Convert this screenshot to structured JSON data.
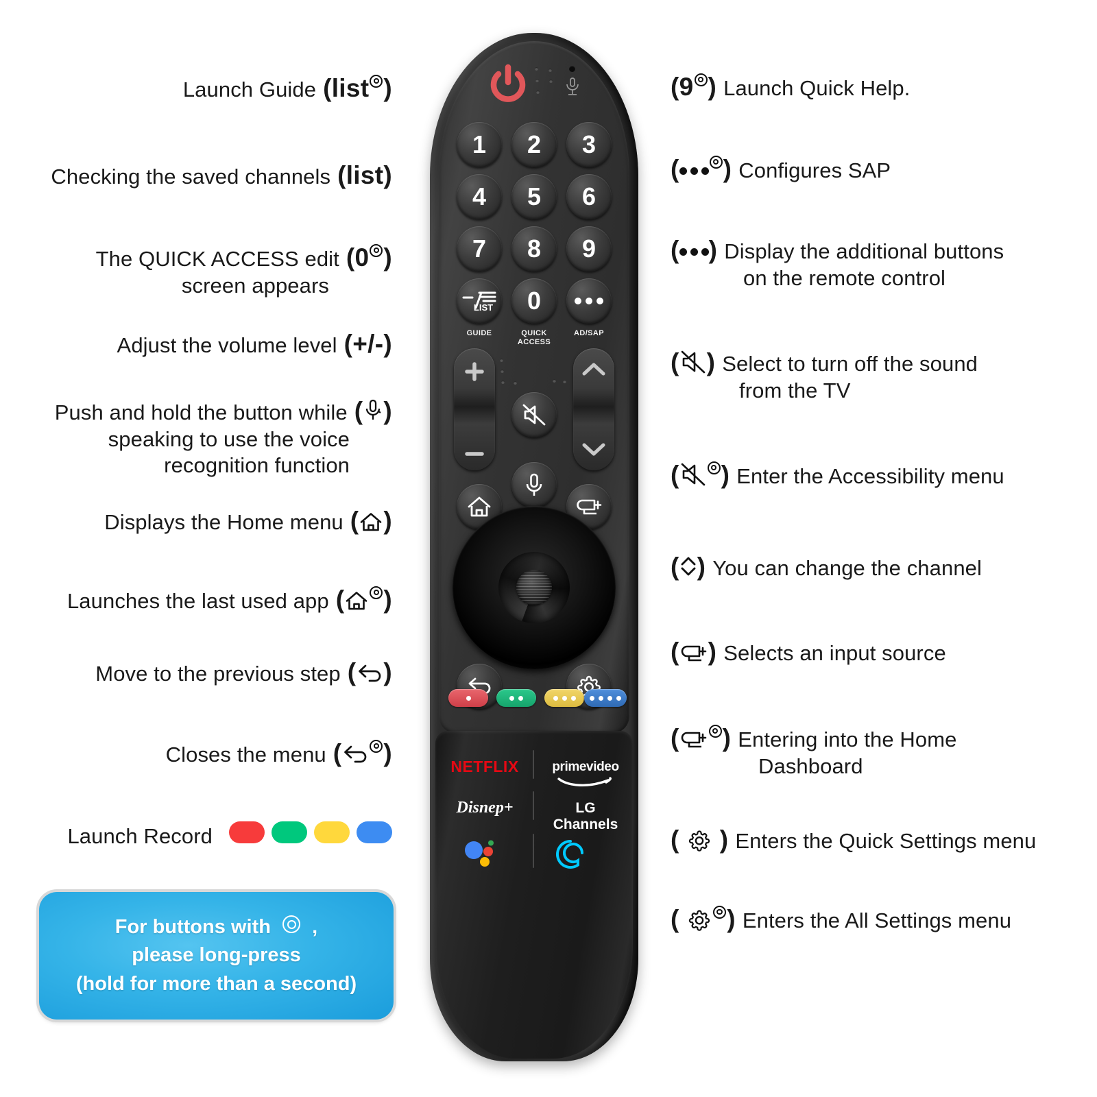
{
  "title": "LG Magic Remote button guide",
  "note": {
    "lines": [
      "For buttons with  ◎  ,",
      "please long-press",
      "(hold for more than a second)"
    ],
    "bg_color": "#2bacdf",
    "text_color": "#ffffff"
  },
  "long_press_symbol": "◎",
  "left_callouts": [
    {
      "desc": "Launch Guide",
      "key": "(list◎)",
      "key_plain": "list",
      "lines": [
        "Launch Guide"
      ]
    },
    {
      "desc": "Checking the saved channels",
      "key": "(list)",
      "key_plain": "list",
      "lines": [
        "Checking the saved channels"
      ]
    },
    {
      "desc": "The QUICK ACCESS edit screen appears",
      "key": "(0◎)",
      "key_plain": "0",
      "lines": [
        "The QUICK ACCESS edit",
        "screen appears"
      ]
    },
    {
      "desc": "Adjust the volume level",
      "key": "(+/-)",
      "key_plain": "+/-",
      "lines": [
        "Adjust the volume level"
      ]
    },
    {
      "desc": "Push and hold the button while speaking to use the voice recognition function",
      "key": "(mic)",
      "key_plain": "mic",
      "lines": [
        "Push and hold the button while",
        "speaking to use the voice",
        "recognition function"
      ]
    },
    {
      "desc": "Displays the Home menu",
      "key": "(home)",
      "key_plain": "home",
      "lines": [
        "Displays the Home menu"
      ]
    },
    {
      "desc": "Launches the last used app",
      "key": "(home◎)",
      "key_plain": "home",
      "lines": [
        "Launches the last used app"
      ]
    },
    {
      "desc": "Move to the previous step",
      "key": "(back)",
      "key_plain": "back",
      "lines": [
        "Move to the previous step"
      ]
    },
    {
      "desc": "Closes the menu",
      "key": "(back◎)",
      "key_plain": "back",
      "lines": [
        "Closes the menu"
      ]
    },
    {
      "desc": "Launch Record",
      "key": "colour buttons",
      "key_plain": "colour",
      "lines": [
        "Launch Record"
      ]
    }
  ],
  "left_record_colors": [
    "#f73b3b",
    "#00c87d",
    "#ffd83c",
    "#3d8cf2"
  ],
  "right_callouts": [
    {
      "key": "(9◎)",
      "lines": [
        "Launch Quick Help."
      ]
    },
    {
      "key": "(•••◎)",
      "lines": [
        "Configures SAP"
      ]
    },
    {
      "key": "(•••)",
      "lines": [
        "Display the additional buttons",
        "on the remote control"
      ]
    },
    {
      "key": "(mute)",
      "lines": [
        "Select to turn off the sound",
        "from the TV"
      ]
    },
    {
      "key": "(mute◎)",
      "lines": [
        "Enter the Accessibility menu"
      ]
    },
    {
      "key": "(ch ▲▼)",
      "lines": [
        "You can change the channel"
      ]
    },
    {
      "key": "(input)",
      "lines": [
        "Selects an input source"
      ]
    },
    {
      "key": "(input◎)",
      "lines": [
        "Entering into the Home",
        "Dashboard"
      ]
    },
    {
      "key": "(gear)",
      "lines": [
        "Enters the Quick Settings menu"
      ]
    },
    {
      "key": "(gear◎)",
      "lines": [
        "Enters the All Settings menu"
      ]
    }
  ],
  "remote": {
    "power_color": "#e1575a",
    "keypad": [
      "1",
      "2",
      "3",
      "4",
      "5",
      "6",
      "7",
      "8",
      "9"
    ],
    "zero_key": "0",
    "list_key_label": "LIST",
    "under_labels": [
      "GUIDE",
      "QUICK\nACCESS",
      "AD/SAP"
    ],
    "under_label_guide": "GUIDE",
    "under_label_quick1": "QUICK",
    "under_label_quick2": "ACCESS",
    "under_label_adsap": "AD/SAP",
    "color_buttons": [
      {
        "name": "record-red",
        "color": "#e0545c",
        "dots": 1
      },
      {
        "name": "green",
        "color": "#21ba7e",
        "dots": 2
      },
      {
        "name": "yellow",
        "color": "#edcb54",
        "dots": 3
      },
      {
        "name": "blue",
        "color": "#3f7fd0",
        "dots": 4
      }
    ],
    "apps": [
      {
        "label": "NETFLIX",
        "color": "#e50914"
      },
      {
        "label": "primevideo",
        "color": "#ffffff"
      },
      {
        "label": "Disnep+",
        "color": "#ffffff"
      },
      {
        "label": "LG Channels",
        "color": "#ffffff"
      }
    ],
    "assistants": [
      "google-assistant",
      "alexa"
    ]
  }
}
